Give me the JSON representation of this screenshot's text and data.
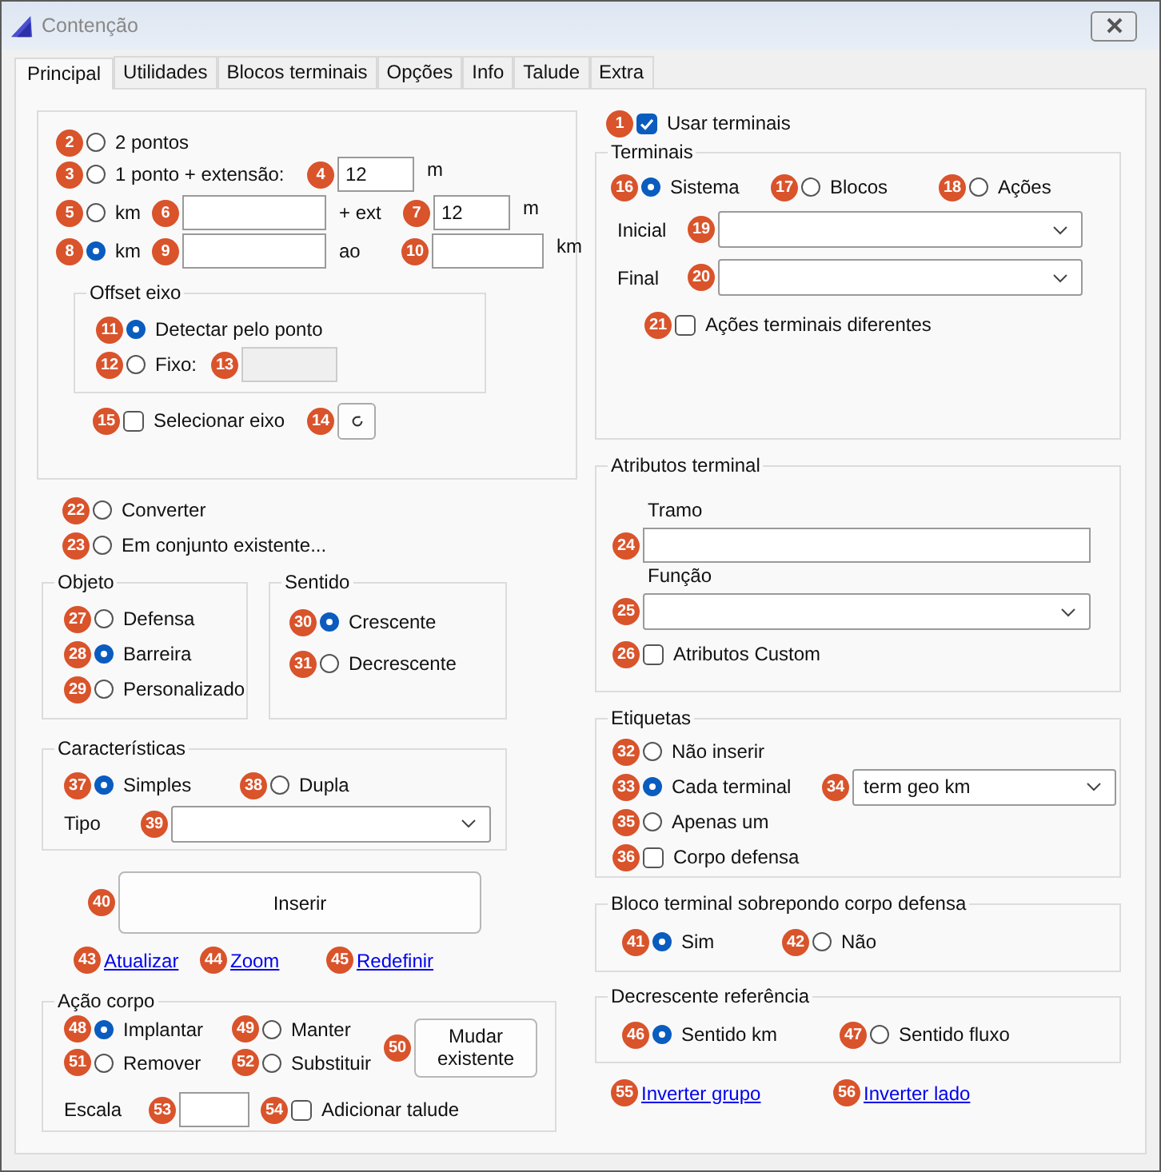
{
  "window": {
    "title": "Contenção"
  },
  "tabs": [
    {
      "label": "Principal",
      "selected": true
    },
    {
      "label": "Utilidades",
      "selected": false
    },
    {
      "label": "Blocos terminais",
      "selected": false
    },
    {
      "label": "Opções",
      "selected": false
    },
    {
      "label": "Info",
      "selected": false
    },
    {
      "label": "Talude",
      "selected": false
    },
    {
      "label": "Extra",
      "selected": false
    }
  ],
  "placement": {
    "two_points": {
      "badge": "2",
      "label": "2 pontos",
      "selected": false
    },
    "one_point": {
      "badge": "3",
      "label": "1 ponto + extensão:",
      "selected": false
    },
    "extension_field": {
      "badge": "4",
      "value": "12"
    },
    "extension_unit": "m",
    "km_extension": {
      "badge": "5",
      "label": "km",
      "selected": false
    },
    "km_field": {
      "badge": "6"
    },
    "ext_label": "+ ext",
    "ext_field": {
      "badge": "7",
      "value": "12"
    },
    "ext_unit": "m",
    "km_range": {
      "badge": "8",
      "label": "km",
      "selected": true
    },
    "km_start_field": {
      "badge": "9"
    },
    "range_label": "ao",
    "km_end_field": {
      "badge": "10"
    },
    "range_unit": "km",
    "offset": {
      "title": "Offset eixo",
      "detect": {
        "badge": "11",
        "label": "Detectar pelo ponto",
        "selected": true
      },
      "fixed": {
        "badge": "12",
        "label": "Fixo:",
        "selected": false
      },
      "fixed_field": {
        "badge": "13",
        "disabled": true
      }
    },
    "select_axis": {
      "badge": "15",
      "label": "Selecionar eixo",
      "checked": false
    },
    "refresh_button": {
      "badge": "14"
    }
  },
  "mode": [
    {
      "badge": "22",
      "label": "Converter",
      "selected": false
    },
    {
      "badge": "23",
      "label": "Em conjunto existente...",
      "selected": false
    }
  ],
  "object": {
    "title": "Objeto",
    "options": [
      {
        "badge": "27",
        "label": "Defensa",
        "selected": false
      },
      {
        "badge": "28",
        "label": "Barreira",
        "selected": true
      },
      {
        "badge": "29",
        "label": "Personalizado",
        "selected": false
      }
    ]
  },
  "direction": {
    "title": "Sentido",
    "options": [
      {
        "badge": "30",
        "label": "Crescente",
        "selected": true
      },
      {
        "badge": "31",
        "label": "Decrescente",
        "selected": false
      }
    ]
  },
  "characteristics": {
    "title": "Características",
    "options": [
      {
        "badge": "37",
        "label": "Simples",
        "selected": true
      },
      {
        "badge": "38",
        "label": "Dupla",
        "selected": false
      }
    ],
    "type_label": "Tipo",
    "type_combo": {
      "badge": "39"
    }
  },
  "insert_button": {
    "badge": "40",
    "label": "Inserir"
  },
  "links": [
    {
      "badge": "43",
      "label": "Atualizar"
    },
    {
      "badge": "44",
      "label": "Zoom"
    },
    {
      "badge": "45",
      "label": "Redefinir"
    }
  ],
  "body_action": {
    "title": "Ação corpo",
    "options": [
      {
        "badge": "48",
        "label": "Implantar",
        "selected": true
      },
      {
        "badge": "49",
        "label": "Manter",
        "selected": false
      },
      {
        "badge": "51",
        "label": "Remover",
        "selected": false
      },
      {
        "badge": "52",
        "label": "Substituir",
        "selected": false
      }
    ],
    "change_button": {
      "badge": "50",
      "label": "Mudar existente"
    },
    "scale_label": "Escala",
    "scale_field": {
      "badge": "53"
    },
    "add_slope": {
      "badge": "54",
      "label": "Adicionar talude",
      "checked": false
    }
  },
  "use_terminals": {
    "badge": "1",
    "label": "Usar terminais",
    "checked": true
  },
  "terminals": {
    "title": "Terminais",
    "options": [
      {
        "badge": "16",
        "label": "Sistema",
        "selected": true
      },
      {
        "badge": "17",
        "label": "Blocos",
        "selected": false
      },
      {
        "badge": "18",
        "label": "Ações",
        "selected": false
      }
    ],
    "initial_label": "Inicial",
    "initial_combo": {
      "badge": "19"
    },
    "final_label": "Final",
    "final_combo": {
      "badge": "20"
    },
    "different_actions": {
      "badge": "21",
      "label": "Ações terminais diferentes",
      "checked": false
    }
  },
  "terminal_attributes": {
    "title": "Atributos terminal",
    "section_label": "Tramo",
    "section_field": {
      "badge": "24"
    },
    "function_label": "Função",
    "function_combo": {
      "badge": "25"
    },
    "custom": {
      "badge": "26",
      "label": "Atributos Custom",
      "checked": false
    }
  },
  "labels": {
    "title": "Etiquetas",
    "options": [
      {
        "badge": "32",
        "label": "Não inserir",
        "selected": false
      },
      {
        "badge": "33",
        "label": "Cada terminal",
        "selected": true
      },
      {
        "badge": "35",
        "label": "Apenas um",
        "selected": false
      }
    ],
    "format_combo": {
      "badge": "34",
      "value": "term geo km"
    },
    "body": {
      "badge": "36",
      "label": "Corpo defensa",
      "checked": false
    }
  },
  "overlap": {
    "title": "Bloco terminal sobrepondo corpo defensa",
    "options": [
      {
        "badge": "41",
        "label": "Sim",
        "selected": true
      },
      {
        "badge": "42",
        "label": "Não",
        "selected": false
      }
    ]
  },
  "descending_reference": {
    "title": "Decrescente referência",
    "options": [
      {
        "badge": "46",
        "label": "Sentido km",
        "selected": true
      },
      {
        "badge": "47",
        "label": "Sentido fluxo",
        "selected": false
      }
    ]
  },
  "bottom_links": [
    {
      "badge": "55",
      "label": "Inverter grupo"
    },
    {
      "badge": "56",
      "label": "Inverter lado"
    }
  ]
}
